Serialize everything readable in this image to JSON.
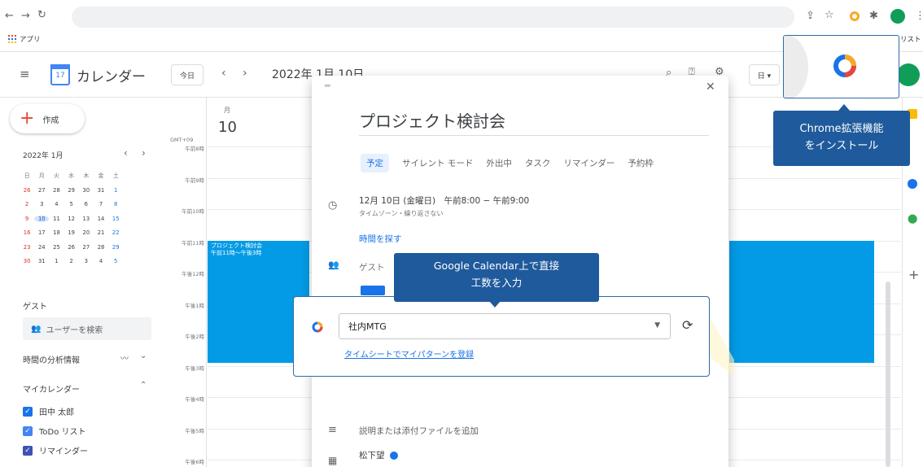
{
  "browser": {
    "bookmark_label": "アプリ",
    "right_label": "リスト"
  },
  "calendar": {
    "app_name": "カレンダー",
    "today_button": "今日",
    "current_date": "2022年 1月 10日",
    "view_button": "日 ▾",
    "logo_day": "17"
  },
  "sidebar": {
    "create_label": "作成",
    "mini_title": "2022年 1月",
    "weekdays": [
      "日",
      "月",
      "火",
      "水",
      "木",
      "金",
      "土"
    ],
    "weeks": [
      [
        "26",
        "27",
        "28",
        "29",
        "30",
        "31",
        "1"
      ],
      [
        "2",
        "3",
        "4",
        "5",
        "6",
        "7",
        "8"
      ],
      [
        "9",
        "10",
        "11",
        "12",
        "13",
        "14",
        "15"
      ],
      [
        "16",
        "17",
        "18",
        "19",
        "20",
        "21",
        "22"
      ],
      [
        "23",
        "24",
        "25",
        "26",
        "27",
        "28",
        "29"
      ],
      [
        "30",
        "31",
        "1",
        "2",
        "3",
        "4",
        "5"
      ]
    ],
    "guest_heading": "ゲスト",
    "search_users": "ユーザーを検索",
    "time_insights": "時間の分析情報",
    "my_calendars": "マイカレンダー",
    "calendars": [
      "田中 太郎",
      "ToDo リスト",
      "リマインダー"
    ]
  },
  "day_view": {
    "weekday": "月",
    "day": "10",
    "timezone": "GMT+09",
    "hours": [
      "午前8時",
      "午前9時",
      "午前10時",
      "午前11時",
      "午後12時",
      "午後1時",
      "午後2時",
      "午後3時",
      "午後4時",
      "午後5時",
      "午後6時"
    ]
  },
  "event": {
    "title": "プロジェクト検討会",
    "time": "午前11時〜午後3時"
  },
  "modal": {
    "title": "プロジェクト検討会",
    "tabs": [
      "予定",
      "サイレント モード",
      "外出中",
      "タスク",
      "リマインダー",
      "予約枠"
    ],
    "datetime": "12月 10日 (金曜日)　午前8:00 − 午前9:00",
    "repeat": "タイムゾーン・繰り返さない",
    "find_time": "時間を探す",
    "guest_placeholder": "ゲスト",
    "description": "説明または添付ファイルを追加",
    "organizer": "松下望"
  },
  "callout": {
    "tooltip": "Google Calendar上で直接\n工数を入力",
    "selected_value": "社内MTG",
    "link": "タイムシートでマイパターンを登録"
  },
  "extension_tooltip": "Chrome拡張機能\nをインストール",
  "colors": {
    "accent": "#1a73e8",
    "event": "#039be5",
    "tooltip": "#1f5a9c",
    "callout_border": "#2f6ba8"
  }
}
